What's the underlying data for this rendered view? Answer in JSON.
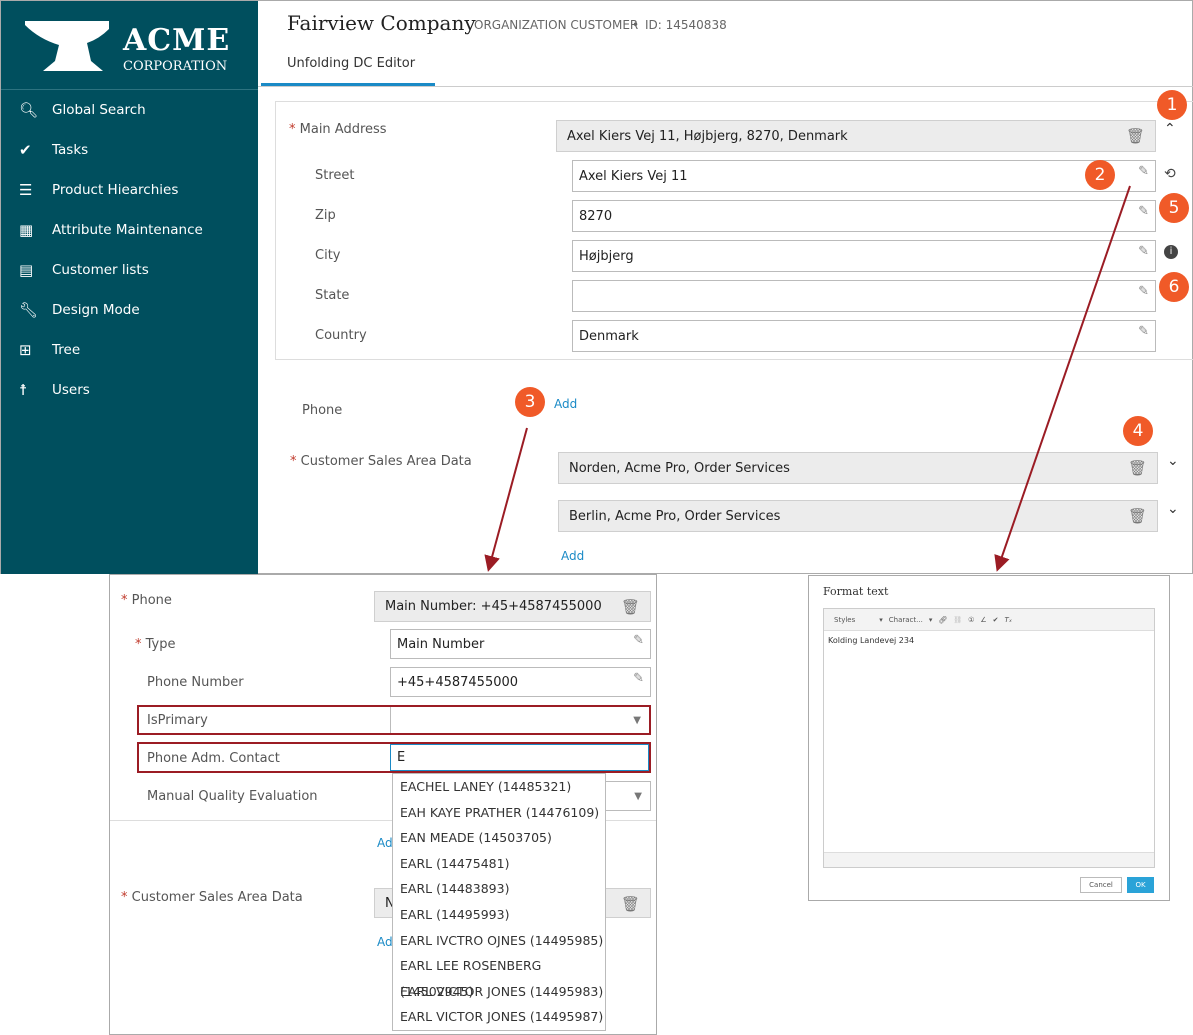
{
  "sidebar": {
    "logo_big": "ACME",
    "logo_small": "CORPORATION",
    "items": [
      {
        "label": "Global Search",
        "icon": "search-icon"
      },
      {
        "label": "Tasks",
        "icon": "check-circle-icon"
      },
      {
        "label": "Product Hiearchies",
        "icon": "hierarchy-icon"
      },
      {
        "label": "Attribute Maintenance",
        "icon": "attribute-icon"
      },
      {
        "label": "Customer lists",
        "icon": "list-icon"
      },
      {
        "label": "Design Mode",
        "icon": "wrench-icon"
      },
      {
        "label": "Tree",
        "icon": "tree-icon"
      },
      {
        "label": "Users",
        "icon": "user-icon"
      }
    ]
  },
  "header": {
    "title": "Fairview Company",
    "type": "ORGANIZATION CUSTOMER",
    "sep": "•",
    "id": "ID: 14540838",
    "tab": "Unfolding DC Editor"
  },
  "address": {
    "label": "Main Address",
    "value": "Axel Kiers Vej 11, Højbjerg, 8270, Denmark",
    "fields": [
      {
        "label": "Street",
        "value": "Axel Kiers Vej 11"
      },
      {
        "label": "Zip",
        "value": "8270"
      },
      {
        "label": "City",
        "value": "Højbjerg"
      },
      {
        "label": "State",
        "value": ""
      },
      {
        "label": "Country",
        "value": "Denmark"
      }
    ]
  },
  "phone": {
    "label": "Phone",
    "add": "Add"
  },
  "sales": {
    "label": "Customer Sales Area Data",
    "items": [
      "Norden, Acme Pro, Order Services",
      "Berlin, Acme Pro, Order Services"
    ],
    "add": "Add"
  },
  "callouts": [
    "1",
    "2",
    "3",
    "4",
    "5",
    "6"
  ],
  "phone_panel": {
    "label": "Phone",
    "value": "Main Number: +45+4587455000",
    "type_label": "Type",
    "type_value": "Main Number",
    "number_label": "Phone Number",
    "number_value": "+45+4587455000",
    "isprimary_label": "IsPrimary",
    "contact_label": "Phone Adm. Contact",
    "contact_value": "E",
    "quality_label": "Manual Quality Evaluation",
    "add": "Ad",
    "sales_label": "Customer Sales Area Data",
    "sales_value": "N",
    "add2": "Ad",
    "options": [
      "EACHEL LANEY (14485321)",
      "EAH KAYE PRATHER (14476109)",
      "EAN MEADE (14503705)",
      "EARL (14475481)",
      "EARL (14483893)",
      "EARL (14495993)",
      "EARL IVCTRO OJNES (14495985)",
      "EARL LEE ROSENBERG (14502945)",
      "EARL VICTOR JONES (14495983)",
      "EARL VICTOR JONES (14495987)"
    ]
  },
  "format": {
    "title": "Format text",
    "styles": "Styles",
    "charact": "Charact...",
    "content": "Kolding Landevej 234",
    "cancel": "Cancel",
    "ok": "OK"
  },
  "colors": {
    "sidebar": "#004f5e",
    "accent": "#1a8ac6",
    "callout": "#f05a28",
    "highlight": "#9b1c24"
  }
}
